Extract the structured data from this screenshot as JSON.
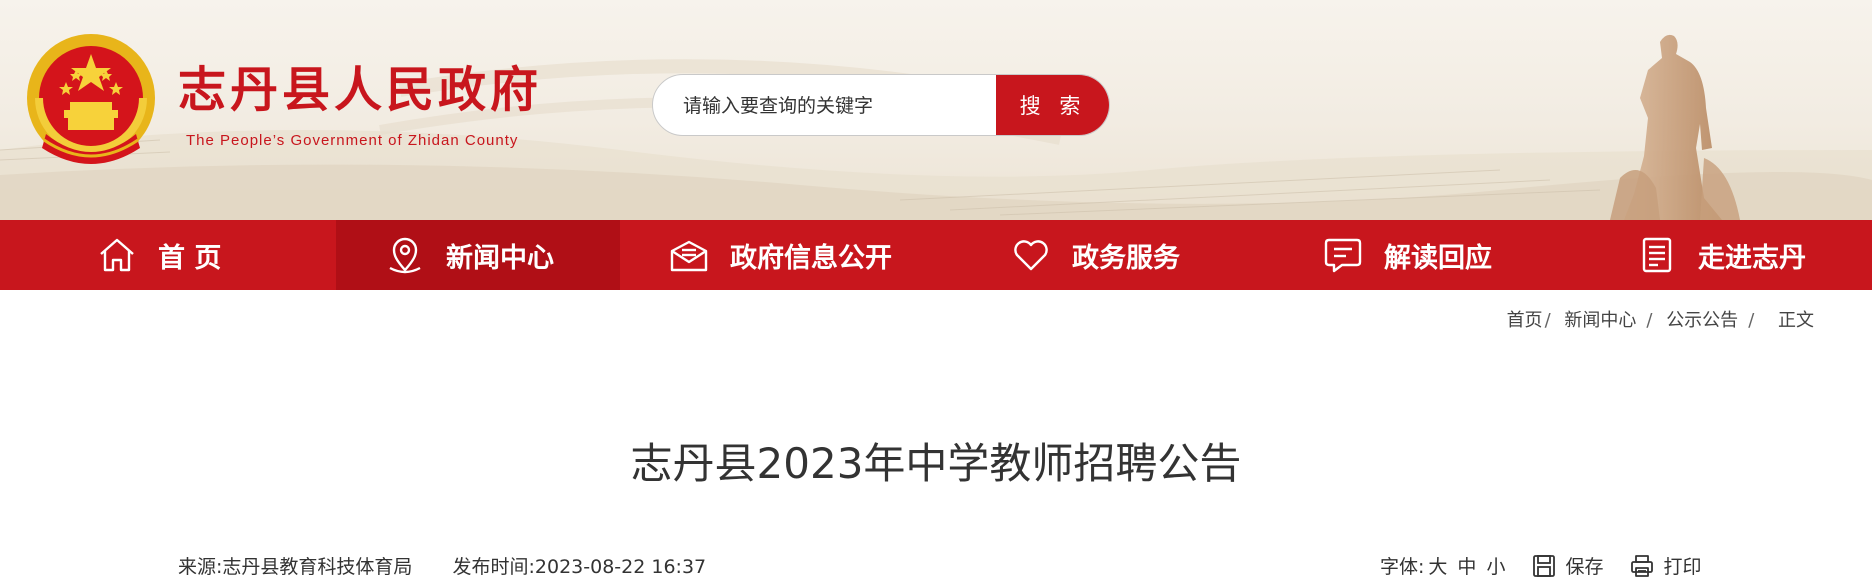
{
  "header": {
    "site_title": "志丹县人民政府",
    "site_subtitle": "The People’s Government of Zhidan County"
  },
  "search": {
    "placeholder": "请输入要查询的关键字",
    "button_label": "搜 索"
  },
  "nav": {
    "items": [
      {
        "label": "首 页",
        "icon": "home-icon",
        "active": false
      },
      {
        "label": "新闻中心",
        "icon": "location-pin-icon",
        "active": true
      },
      {
        "label": "政府信息公开",
        "icon": "mail-icon",
        "active": false
      },
      {
        "label": "政务服务",
        "icon": "heart-icon",
        "active": false
      },
      {
        "label": "解读回应",
        "icon": "chat-icon",
        "active": false
      },
      {
        "label": "走进志丹",
        "icon": "document-icon",
        "active": false
      }
    ]
  },
  "breadcrumb": {
    "items": [
      "首页",
      "新闻中心",
      "公示公告",
      "正文"
    ],
    "separator": "/"
  },
  "article": {
    "title": "志丹县2023年中学教师招聘公告",
    "source_label": "来源:",
    "source": "志丹县教育科技体育局",
    "time_label": "发布时间:",
    "time": "2023-08-22 16:37"
  },
  "tools": {
    "font_label": "字体:",
    "font_large": "大",
    "font_medium": "中",
    "font_small": "小",
    "save_label": "保存",
    "print_label": "打印"
  },
  "colors": {
    "brand_red": "#c8161d",
    "nav_active": "#b00f16",
    "header_bg": "#f4efe6",
    "text": "#333333"
  }
}
